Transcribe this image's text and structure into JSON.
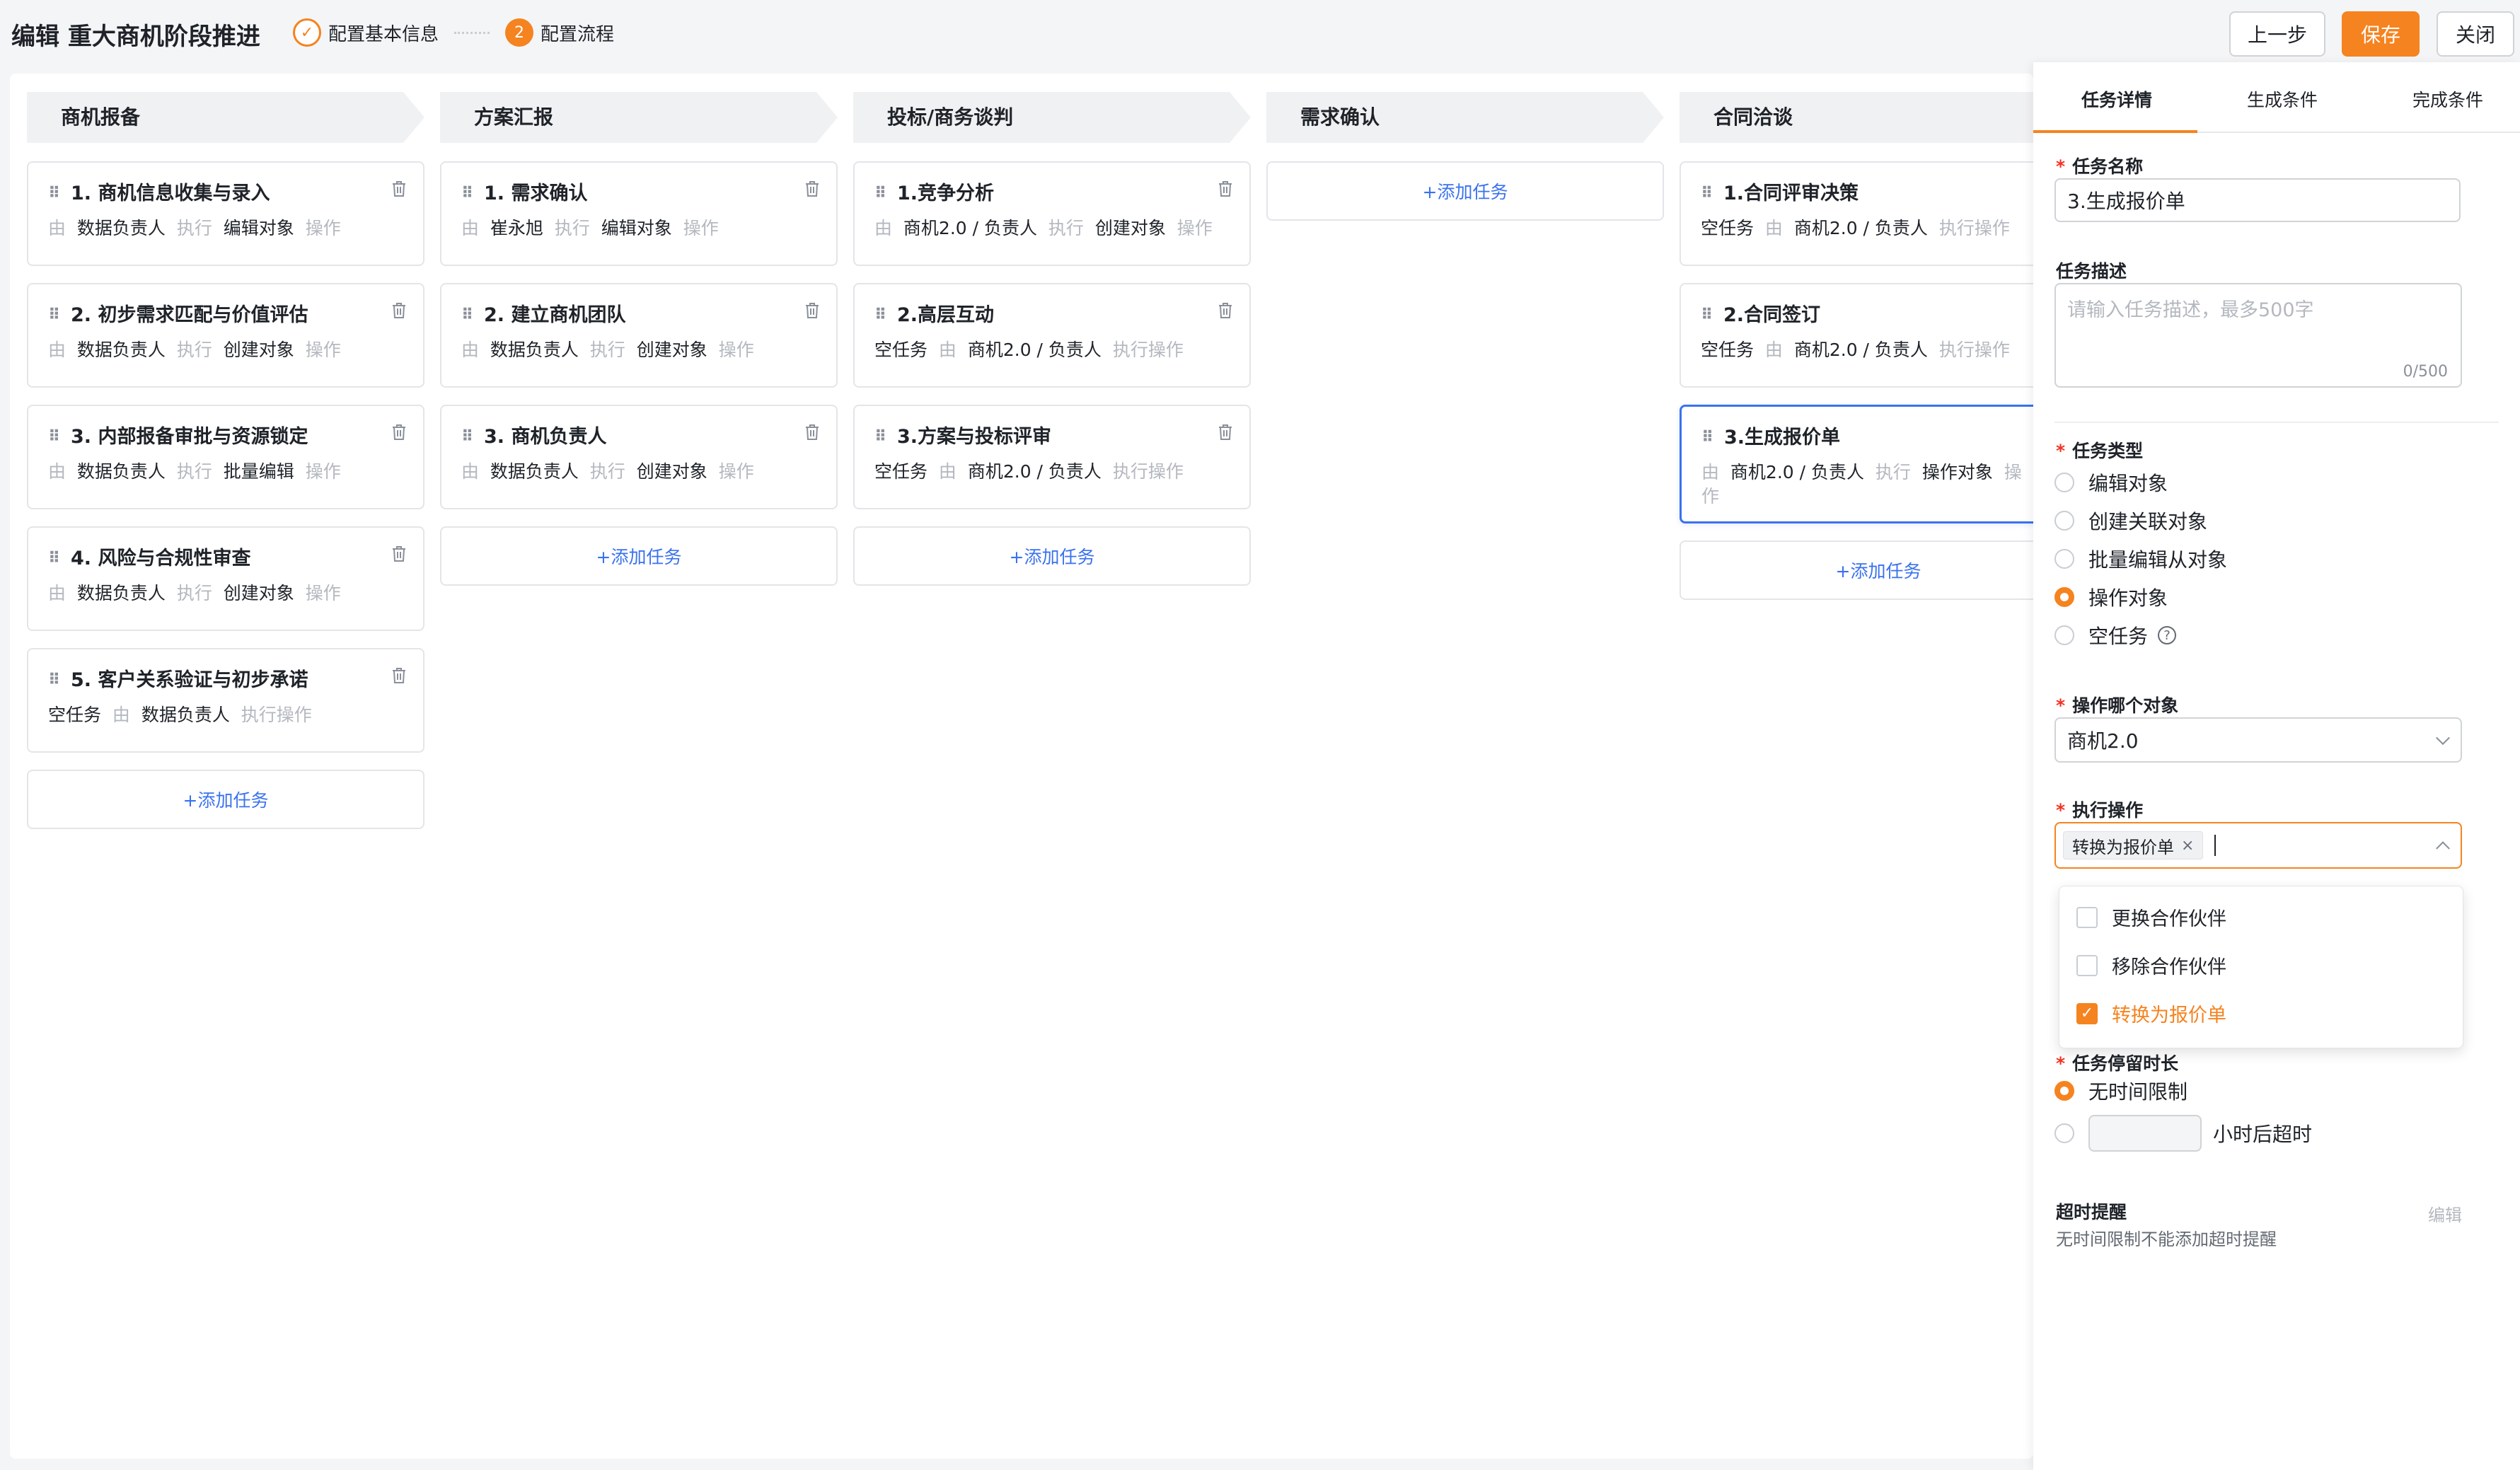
{
  "header": {
    "title": "编辑 重大商机阶段推进",
    "steps": [
      {
        "label": "配置基本信息",
        "status": "done"
      },
      {
        "label": "配置流程",
        "number": "2",
        "status": "active"
      }
    ],
    "prev_label": "上一步",
    "save_label": "保存",
    "close_label": "关闭",
    "accent_color": "#f5831f"
  },
  "columns": [
    {
      "title": "商机报备",
      "cards": [
        {
          "title": "1. 商机信息收集与录入",
          "meta": [
            [
              "由",
              "muted"
            ],
            [
              "数据负责人",
              ""
            ],
            [
              "执行",
              "muted"
            ],
            [
              "编辑对象",
              ""
            ],
            [
              "操作",
              "muted"
            ]
          ]
        },
        {
          "title": "2. 初步需求匹配与价值评估",
          "meta": [
            [
              "由",
              "muted"
            ],
            [
              "数据负责人",
              ""
            ],
            [
              "执行",
              "muted"
            ],
            [
              "创建对象",
              ""
            ],
            [
              "操作",
              "muted"
            ]
          ]
        },
        {
          "title": "3. 内部报备审批与资源锁定",
          "meta": [
            [
              "由",
              "muted"
            ],
            [
              "数据负责人",
              ""
            ],
            [
              "执行",
              "muted"
            ],
            [
              "批量编辑",
              ""
            ],
            [
              "操作",
              "muted"
            ]
          ]
        },
        {
          "title": "4. 风险与合规性审查",
          "meta": [
            [
              "由",
              "muted"
            ],
            [
              "数据负责人",
              ""
            ],
            [
              "执行",
              "muted"
            ],
            [
              "创建对象",
              ""
            ],
            [
              "操作",
              "muted"
            ]
          ]
        },
        {
          "title": "5. 客户关系验证与初步承诺",
          "meta": [
            [
              "空任务",
              ""
            ],
            [
              "由",
              "muted"
            ],
            [
              "数据负责人",
              ""
            ],
            [
              "执行操作",
              "muted"
            ]
          ]
        }
      ],
      "add_label": "+添加任务"
    },
    {
      "title": "方案汇报",
      "cards": [
        {
          "title": "1. 需求确认",
          "meta": [
            [
              "由",
              "muted"
            ],
            [
              "崔永旭",
              ""
            ],
            [
              "执行",
              "muted"
            ],
            [
              "编辑对象",
              ""
            ],
            [
              "操作",
              "muted"
            ]
          ]
        },
        {
          "title": "2. 建立商机团队",
          "meta": [
            [
              "由",
              "muted"
            ],
            [
              "数据负责人",
              ""
            ],
            [
              "执行",
              "muted"
            ],
            [
              "创建对象",
              ""
            ],
            [
              "操作",
              "muted"
            ]
          ]
        },
        {
          "title": "3. 商机负责人",
          "meta": [
            [
              "由",
              "muted"
            ],
            [
              "数据负责人",
              ""
            ],
            [
              "执行",
              "muted"
            ],
            [
              "创建对象",
              ""
            ],
            [
              "操作",
              "muted"
            ]
          ]
        }
      ],
      "add_label": "+添加任务"
    },
    {
      "title": "投标/商务谈判",
      "cards": [
        {
          "title": "1.竞争分析",
          "meta": [
            [
              "由",
              "muted"
            ],
            [
              "商机2.0 / 负责人",
              ""
            ],
            [
              "执行",
              "muted"
            ],
            [
              "创建对象",
              ""
            ],
            [
              "操作",
              "muted"
            ]
          ]
        },
        {
          "title": "2.高层互动",
          "meta": [
            [
              "空任务",
              ""
            ],
            [
              "由",
              "muted"
            ],
            [
              "商机2.0 / 负责人",
              ""
            ],
            [
              "执行操作",
              "muted"
            ]
          ]
        },
        {
          "title": "3.方案与投标评审",
          "meta": [
            [
              "空任务",
              ""
            ],
            [
              "由",
              "muted"
            ],
            [
              "商机2.0 / 负责人",
              ""
            ],
            [
              "执行操作",
              "muted"
            ]
          ]
        }
      ],
      "add_label": "+添加任务"
    },
    {
      "title": "需求确认",
      "cards": [],
      "add_label": "+添加任务"
    },
    {
      "title": "合同洽谈",
      "cards": [
        {
          "title": "1.合同评审决策",
          "meta": [
            [
              "空任务",
              ""
            ],
            [
              "由",
              "muted"
            ],
            [
              "商机2.0 / 负责人",
              ""
            ],
            [
              "执行操作",
              "muted"
            ]
          ]
        },
        {
          "title": "2.合同签订",
          "meta": [
            [
              "空任务",
              ""
            ],
            [
              "由",
              "muted"
            ],
            [
              "商机2.0 / 负责人",
              ""
            ],
            [
              "执行操作",
              "muted"
            ]
          ]
        },
        {
          "title": "3.生成报价单",
          "selected": true,
          "meta": [
            [
              "由",
              "muted"
            ],
            [
              "商机2.0 / 负责人",
              ""
            ],
            [
              "执行",
              "muted"
            ],
            [
              "操作对象",
              ""
            ],
            [
              "操作",
              "muted"
            ]
          ]
        }
      ],
      "add_label": "+添加任务"
    }
  ],
  "panel": {
    "tabs": [
      "任务详情",
      "生成条件",
      "完成条件"
    ],
    "task_name_label": "任务名称",
    "task_name_value": "3.生成报价单",
    "desc_label": "任务描述",
    "desc_placeholder": "请输入任务描述，最多500字",
    "desc_counter": "0/500",
    "type_label": "任务类型",
    "type_options": [
      "编辑对象",
      "创建关联对象",
      "批量编辑从对象",
      "操作对象",
      "空任务"
    ],
    "type_selected": "操作对象",
    "help_glyph": "?",
    "object_label": "操作哪个对象",
    "object_value": "商机2.0",
    "action_label": "执行操作",
    "action_tag": "转换为报价单",
    "action_tag_close": "×",
    "action_options": [
      {
        "label": "更换合作伙伴",
        "checked": false
      },
      {
        "label": "移除合作伙伴",
        "checked": false
      },
      {
        "label": "转换为报价单",
        "checked": true
      }
    ],
    "check_glyph": "✓",
    "stay_label": "任务停留时长",
    "stay_opt1": "无时间限制",
    "stay_opt2_suffix": "小时后超时",
    "timeout_label": "超时提醒",
    "timeout_edit": "编辑",
    "timeout_note": "无时间限制不能添加超时提醒"
  }
}
